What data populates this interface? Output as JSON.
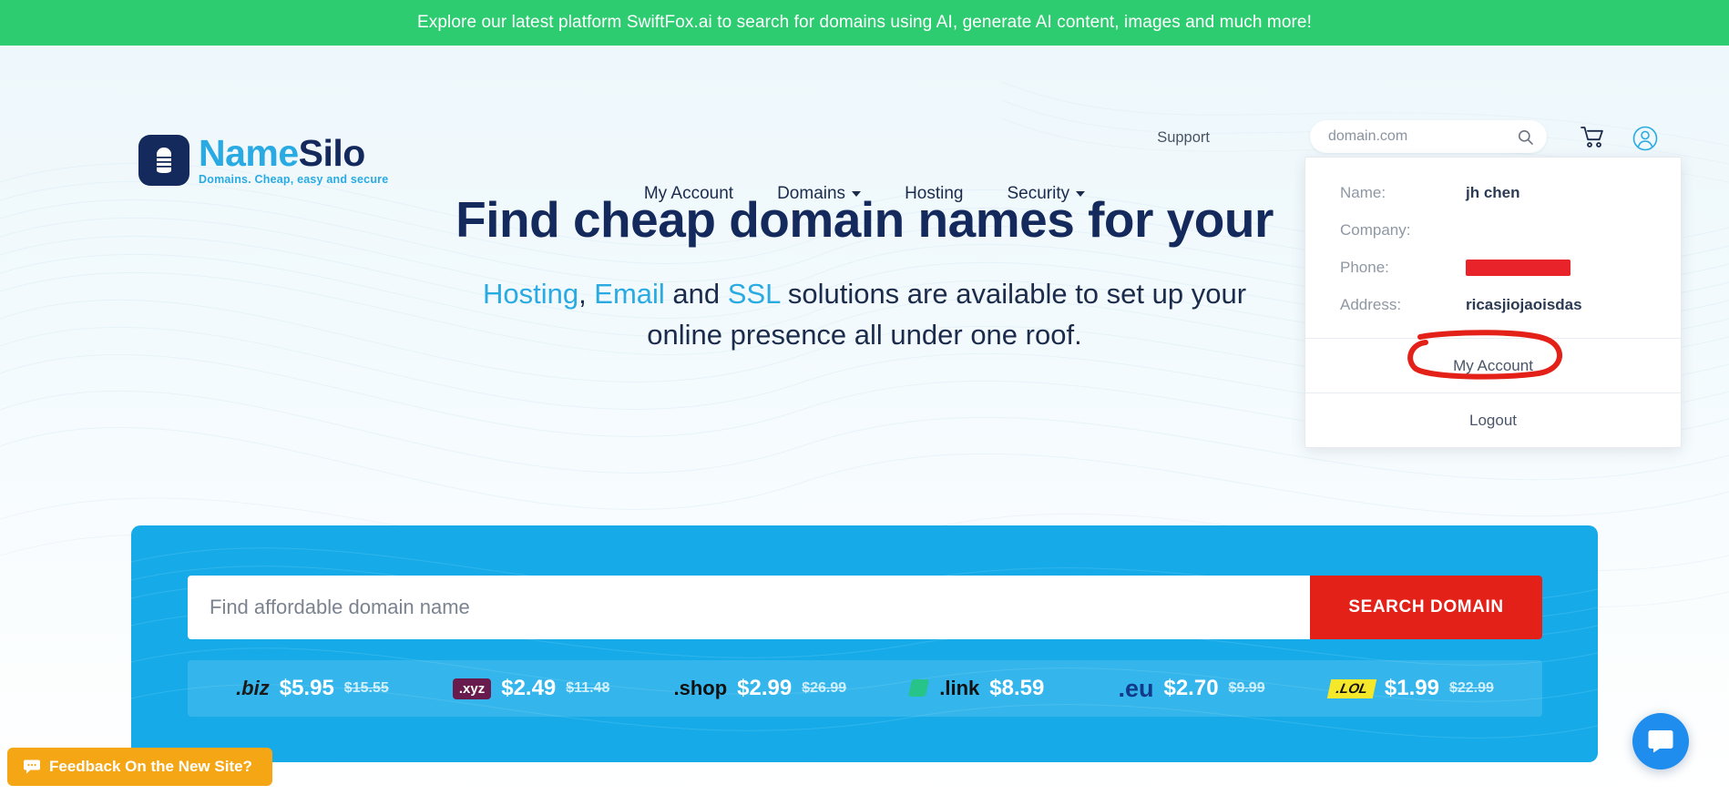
{
  "promo": {
    "text": "Explore our latest platform SwiftFox.ai to search for domains using AI, generate AI content, images and much more!",
    "bg_color": "#2ecc71"
  },
  "header": {
    "logo": {
      "name_part": "Name",
      "silo_part": "Silo",
      "tagline": "Domains. Cheap, easy and secure",
      "mark_icon": "database-silo-icon"
    },
    "support_label": "Support",
    "search": {
      "placeholder": "domain.com",
      "value": "",
      "icon": "search-icon"
    },
    "cart_icon": "shopping-cart-icon",
    "user_icon": "user-circle-icon"
  },
  "nav": {
    "items": [
      {
        "label": "My Account",
        "has_caret": false
      },
      {
        "label": "Domains",
        "has_caret": true
      },
      {
        "label": "Hosting",
        "has_caret": false
      },
      {
        "label": "Security",
        "has_caret": true
      }
    ]
  },
  "account_dropdown": {
    "rows": [
      {
        "label": "Name:",
        "value": "jh chen",
        "redacted": false
      },
      {
        "label": "Company:",
        "value": "",
        "redacted": false
      },
      {
        "label": "Phone:",
        "value": "",
        "redacted": true
      },
      {
        "label": "Address:",
        "value": "ricasjiojaoisdas",
        "redacted": false
      }
    ],
    "my_account_label": "My Account",
    "logout_label": "Logout",
    "annotation_color": "#e32119"
  },
  "hero": {
    "title": "Find cheap domain names for your",
    "sub_pre": "",
    "sub_link1": "Hosting",
    "sub_sep1": ", ",
    "sub_link2": "Email",
    "sub_mid": " and ",
    "sub_link3": "SSL",
    "sub_rest": " solutions are available to set up your",
    "sub_line2": "online presence all under one roof.",
    "accent_color": "#29aae2",
    "title_color": "#14295c"
  },
  "search_panel": {
    "bg_color": "#16abe8",
    "input_placeholder": "Find affordable domain name",
    "input_value": "",
    "button_label": "SEARCH DOMAIN",
    "button_color": "#e32119",
    "tlds": [
      {
        "name": ".biz",
        "style": "biz",
        "price": "$5.95",
        "old_price": "$15.55"
      },
      {
        "name": ".xyz",
        "style": "xyz",
        "price": "$2.49",
        "old_price": "$11.48"
      },
      {
        "name": ".shop",
        "style": "shop",
        "price": "$2.99",
        "old_price": "$26.99"
      },
      {
        "name": ".link",
        "style": "link",
        "price": "$8.59",
        "old_price": ""
      },
      {
        "name": ".eu",
        "style": "eu",
        "price": "$2.70",
        "old_price": "$9.99"
      },
      {
        "name": ".LOL",
        "style": "lol",
        "price": "$1.99",
        "old_price": "$22.99"
      }
    ]
  },
  "feedback": {
    "label": "Feedback On the New Site?",
    "icon": "chat-bubble-icon",
    "color": "#f5a614"
  },
  "chat": {
    "icon": "intercom-chat-icon",
    "color": "#1f8ded"
  }
}
